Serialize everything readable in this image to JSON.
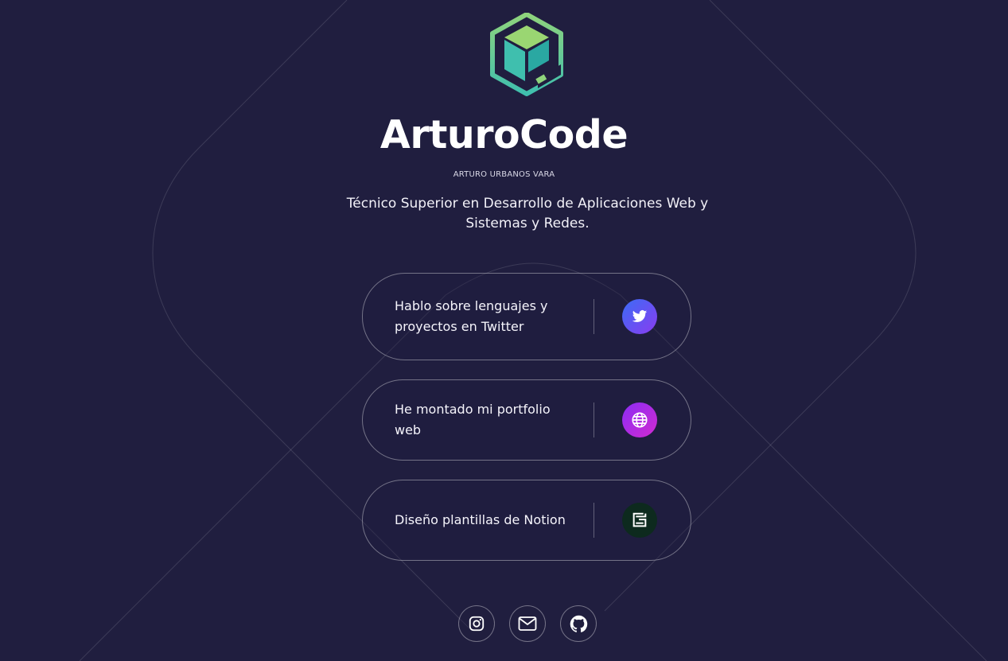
{
  "profile": {
    "brand": "ArturoCode",
    "full_name": "ARTURO URBANOS VARA",
    "description": "Técnico Superior en Desarrollo de Aplicaciones Web y Sistemas y Redes."
  },
  "links": [
    {
      "label": "Hablo sobre lenguajes y proyectos en Twitter",
      "icon": "twitter-icon"
    },
    {
      "label": "He montado mi portfolio web",
      "icon": "globe-icon"
    },
    {
      "label": "Diseño plantillas de Notion",
      "icon": "gumroad-icon"
    }
  ],
  "social": [
    {
      "icon": "instagram-icon"
    },
    {
      "icon": "mail-icon"
    },
    {
      "icon": "github-icon"
    }
  ],
  "colors": {
    "background": "#201e3f",
    "text": "#ffffff",
    "border": "#6e6c88",
    "logo_teal": "#2fb5a9",
    "logo_green": "#8fd47c",
    "twitter_gradient_start": "#3b6cf6",
    "twitter_gradient_end": "#8a3cf0",
    "globe_gradient_start": "#8b2cf5",
    "globe_gradient_end": "#d12bd0",
    "notion_bg": "#0d2a1e"
  }
}
